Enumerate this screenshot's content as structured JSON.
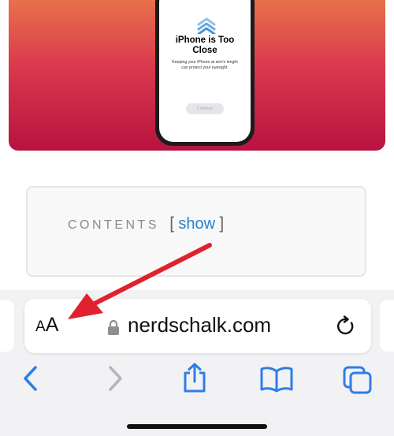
{
  "hero": {
    "title": "iPhone is Too Close",
    "subtitle": "Keeping your iPhone at arm's length can protect your eyesight.",
    "button_label": "Continue"
  },
  "contents": {
    "title": "CONTENTS",
    "open_bracket": "[",
    "link_label": "show",
    "close_bracket": "]"
  },
  "address_bar": {
    "aa_small": "A",
    "aa_large": "A",
    "url": "nerdschalk.com"
  },
  "toolbar": {
    "icons": [
      "back-icon",
      "forward-icon",
      "share-icon",
      "bookmarks-icon",
      "tabs-icon"
    ]
  },
  "colors": {
    "accent": "#2f7de8",
    "annotation_arrow": "#e0212e",
    "hero_top": "#e9704c",
    "hero_bottom": "#b8123f"
  }
}
